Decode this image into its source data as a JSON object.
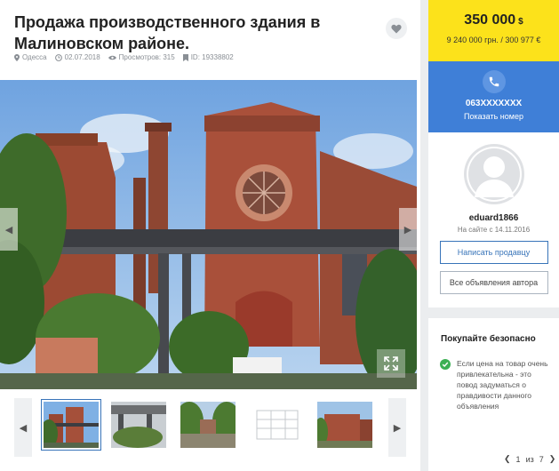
{
  "listing": {
    "title": "Продажа производственного здания в Малиновском районе.",
    "city": "Одесса",
    "date": "02.07.2018",
    "views": "Просмотров: 315",
    "id": "ID: 19338802"
  },
  "price": {
    "main": "350 000",
    "currency": "$",
    "sub": "9 240 000 грн. / 300 977 €"
  },
  "phone": {
    "number": "063XXXXXXX",
    "show_label": "Показать номер"
  },
  "seller": {
    "username": "eduard1866",
    "since": "На сайте с 14.11.2016",
    "write_button": "Написать продавцу",
    "all_ads_button": "Все объявления автора"
  },
  "safety": {
    "title": "Покупайте безопасно",
    "text": "Если цена на товар очень привлекательна - это повод задуматься о правдивости данного объявления",
    "pager_current": "1",
    "pager_of": "из",
    "pager_total": "7"
  },
  "icons": {
    "favorite": "heart-icon",
    "location": "location-pin-icon",
    "date": "clock-icon",
    "views": "eye-icon",
    "id": "bookmark-icon",
    "phone": "phone-icon",
    "expand": "expand-icon",
    "prev": "chevron-left-icon",
    "next": "chevron-right-icon",
    "check": "check-icon"
  },
  "colors": {
    "price_bg": "#fce21b",
    "phone_bg": "#3f7fd7",
    "link": "#3874b9",
    "check": "#3cb054"
  }
}
